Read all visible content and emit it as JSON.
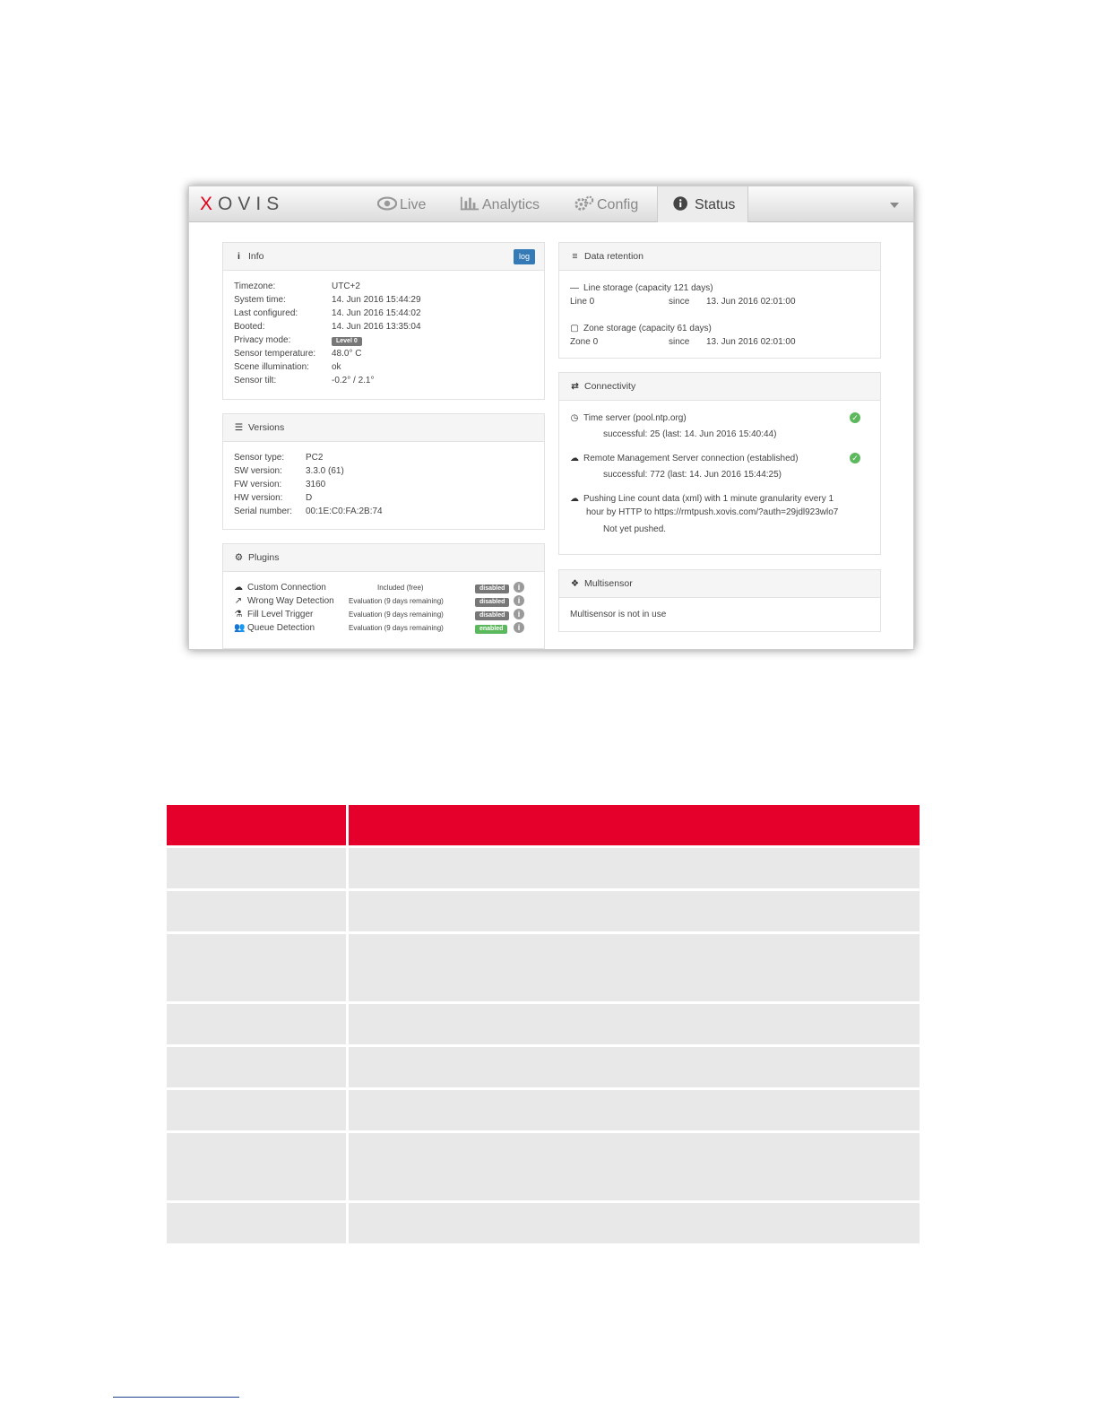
{
  "app": {
    "brand_x": "X",
    "brand_rest": "OVIS",
    "tabs": [
      {
        "label": "Live",
        "icon": "eye-icon"
      },
      {
        "label": "Analytics",
        "icon": "bar-chart-icon"
      },
      {
        "label": "Config",
        "icon": "gears-icon"
      },
      {
        "label": "Status",
        "icon": "info-circle-icon",
        "active": true
      }
    ]
  },
  "info": {
    "title": "Info",
    "log_label": "log",
    "rows": [
      {
        "label": "Timezone:",
        "value": "UTC+2"
      },
      {
        "label": "System time:",
        "value": "14. Jun 2016 15:44:29"
      },
      {
        "label": "Last configured:",
        "value": "14. Jun 2016 15:44:02"
      },
      {
        "label": "Booted:",
        "value": "14. Jun 2016 13:35:04"
      },
      {
        "label": "Privacy mode:",
        "badge": "Level 0"
      },
      {
        "label": "Sensor temperature:",
        "value": "48.0° C"
      },
      {
        "label": "Scene illumination:",
        "value": "ok"
      },
      {
        "label": "Sensor tilt:",
        "value": "-0.2° / 2.1°"
      }
    ]
  },
  "versions": {
    "title": "Versions",
    "rows": [
      {
        "label": "Sensor type:",
        "value": "PC2"
      },
      {
        "label": "SW version:",
        "value": "3.3.0 (61)"
      },
      {
        "label": "FW version:",
        "value": "3160"
      },
      {
        "label": "HW version:",
        "value": "D"
      },
      {
        "label": "Serial number:",
        "value": "00:1E:C0:FA:2B:74"
      }
    ]
  },
  "plugins": {
    "title": "Plugins",
    "rows": [
      {
        "name": "Custom Connection",
        "license": "Included (free)",
        "state": "disabled",
        "icon": "cloud-icon"
      },
      {
        "name": "Wrong Way Detection",
        "license": "Evaluation (9 days remaining)",
        "state": "disabled",
        "icon": "arrows-icon"
      },
      {
        "name": "Fill Level Trigger",
        "license": "Evaluation (9 days remaining)",
        "state": "disabled",
        "icon": "flask-icon"
      },
      {
        "name": "Queue Detection",
        "license": "Evaluation (9 days remaining)",
        "state": "enabled",
        "icon": "users-icon"
      }
    ]
  },
  "retention": {
    "title": "Data retention",
    "line_storage": "Line storage (capacity 121 days)",
    "line_name": "Line 0",
    "line_since_label": "since",
    "line_since": "13. Jun 2016 02:01:00",
    "zone_storage": "Zone storage (capacity 61 days)",
    "zone_name": "Zone 0",
    "zone_since_label": "since",
    "zone_since": "13. Jun 2016 02:01:00"
  },
  "connectivity": {
    "title": "Connectivity",
    "time_server": "Time server (pool.ntp.org)",
    "time_status": "successful:  25  (last: 14. Jun 2016 15:40:44)",
    "remote": "Remote Management Server connection (established)",
    "remote_status": "successful:  772  (last: 14. Jun 2016 15:44:25)",
    "push_line1": "Pushing Line count data (xml) with 1 minute granularity every 1",
    "push_line2": "hour by HTTP to https://rmtpush.xovis.com/?auth=29jdl923wlo7",
    "push_status": "Not yet pushed."
  },
  "multisensor": {
    "title": "Multisensor",
    "text": "Multisensor is not in use"
  },
  "colors": {
    "accent": "#e4002b",
    "row_bg": "#e8e8e8",
    "ok": "#5cb85c",
    "log_button": "#337ab7"
  }
}
